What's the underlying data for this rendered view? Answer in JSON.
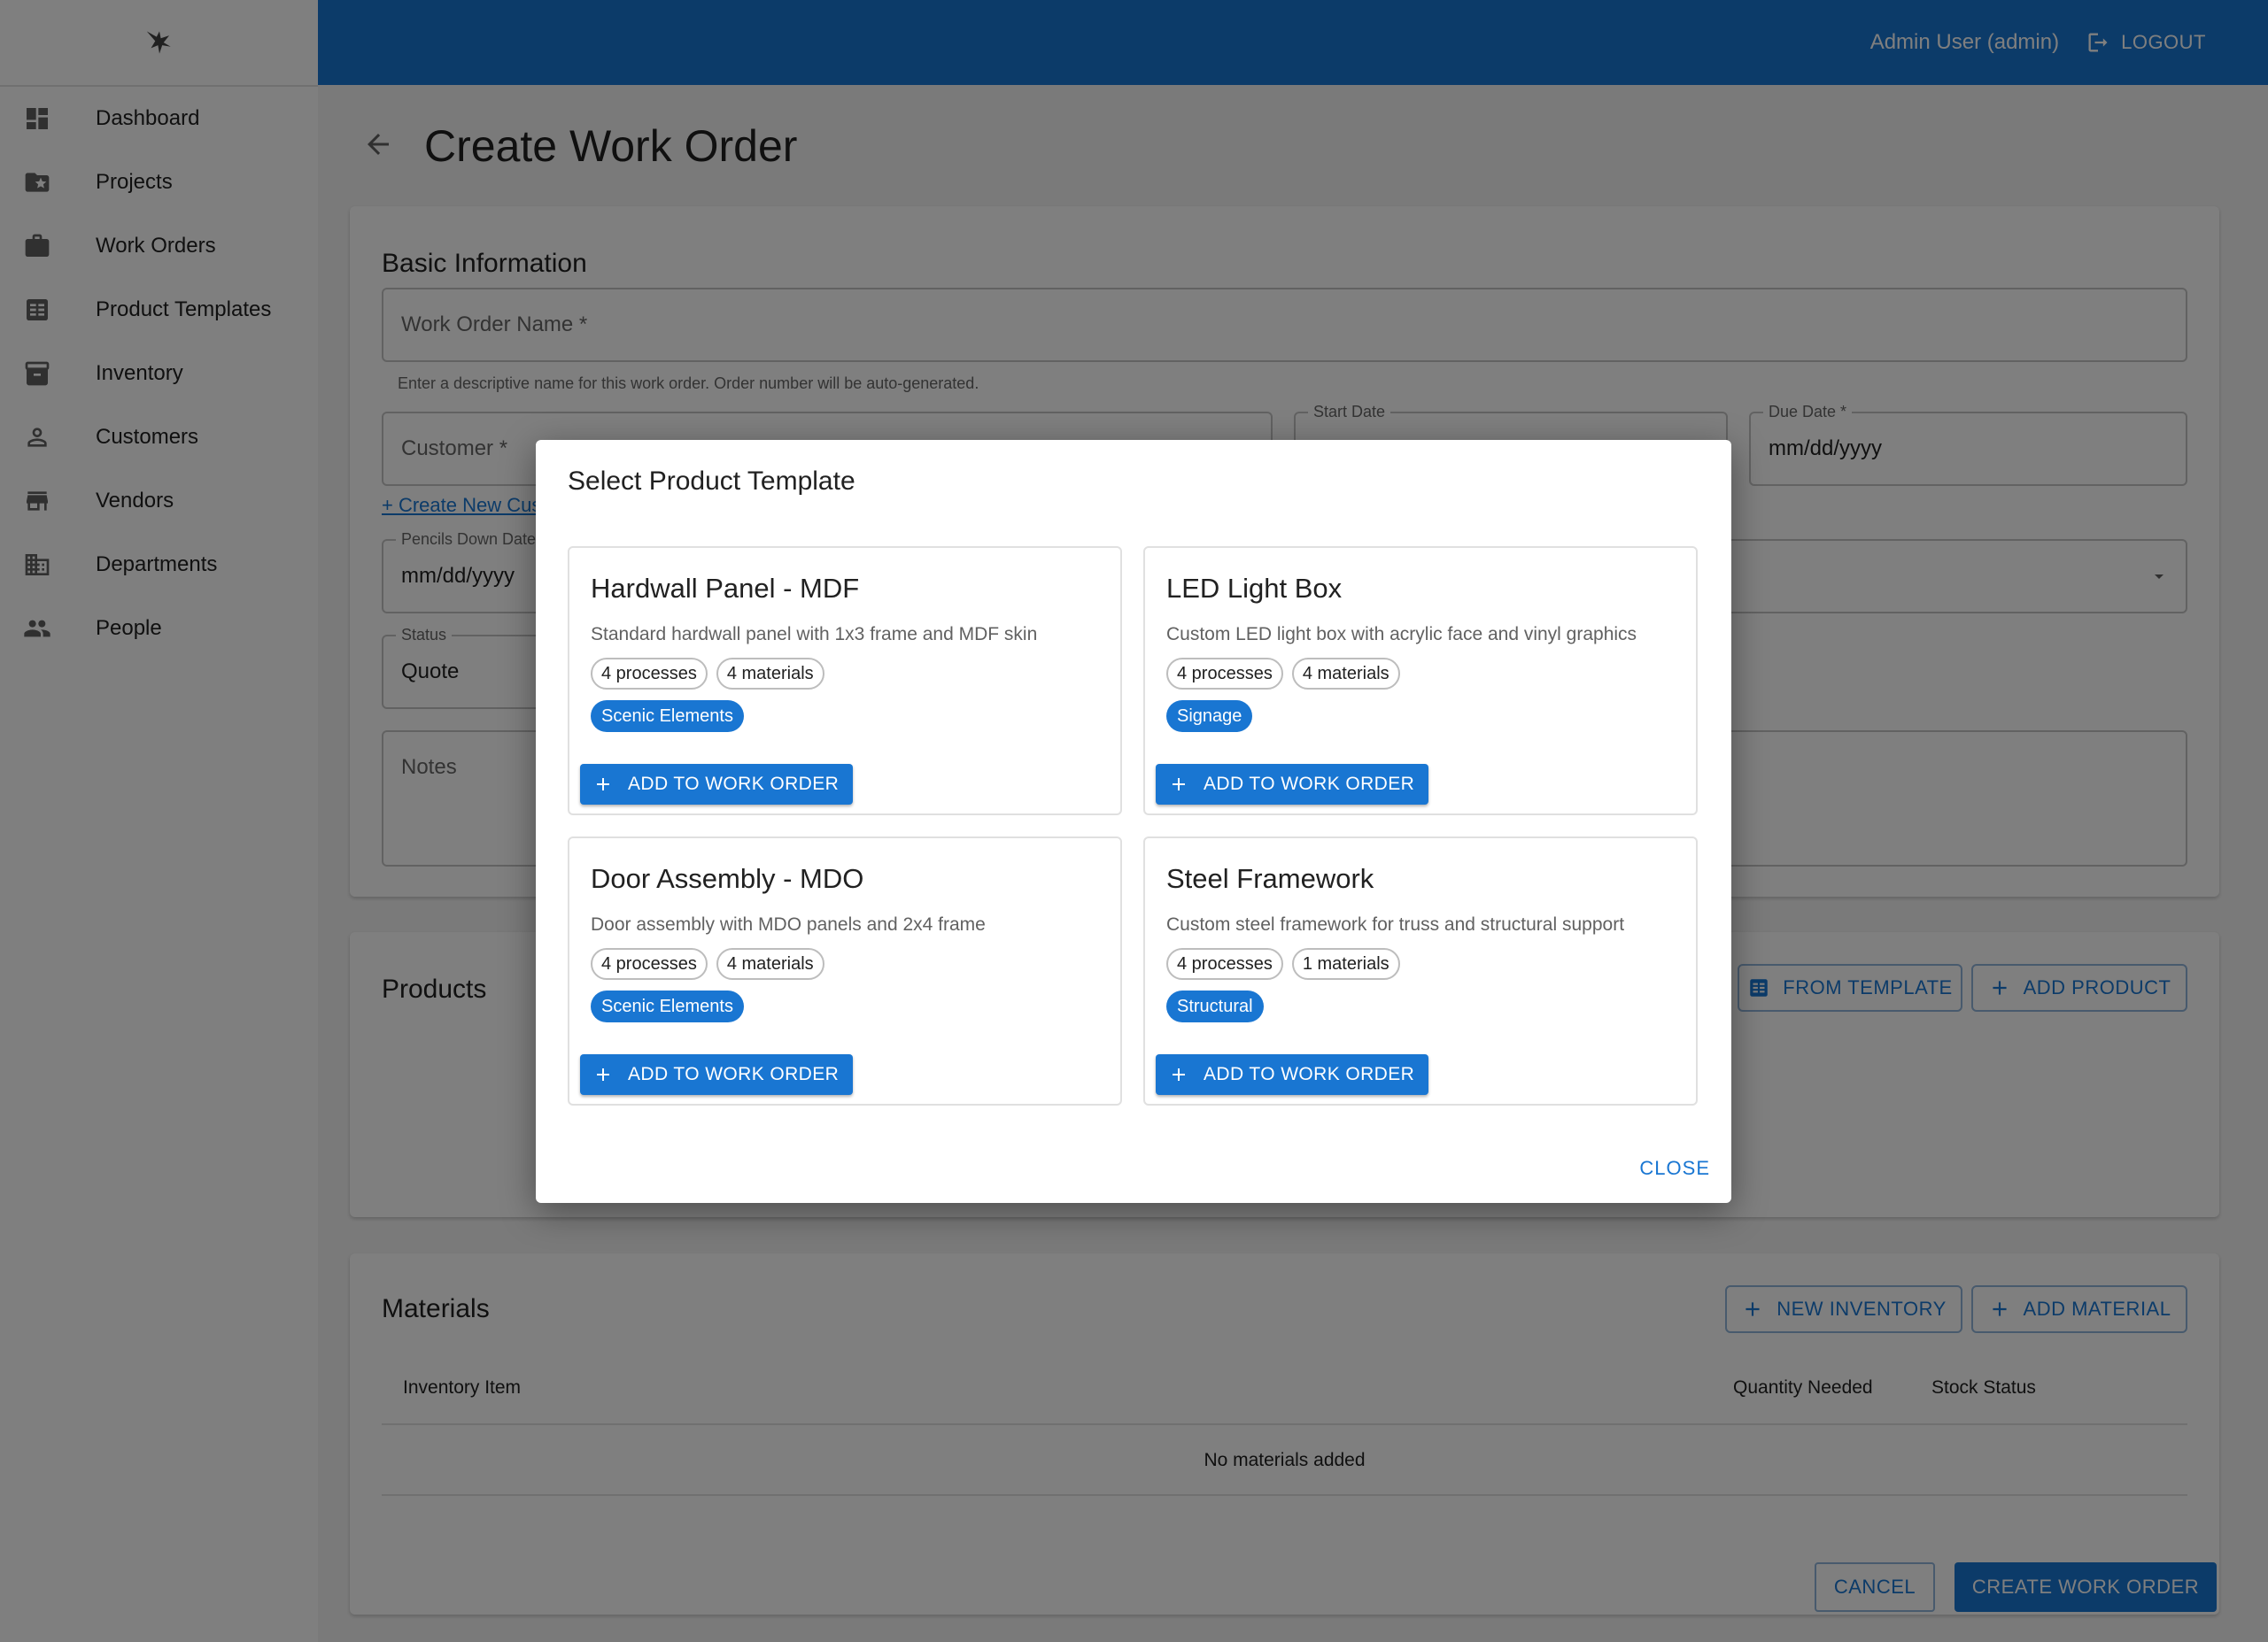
{
  "appbar": {
    "user": "Admin User (admin)",
    "logout": "LOGOUT"
  },
  "sidebar": {
    "items": [
      {
        "label": "Dashboard"
      },
      {
        "label": "Projects"
      },
      {
        "label": "Work Orders"
      },
      {
        "label": "Product Templates"
      },
      {
        "label": "Inventory"
      },
      {
        "label": "Customers"
      },
      {
        "label": "Vendors"
      },
      {
        "label": "Departments"
      },
      {
        "label": "People"
      }
    ]
  },
  "page": {
    "title": "Create Work Order"
  },
  "basic": {
    "title": "Basic Information",
    "name_label": "Work Order Name *",
    "name_helper": "Enter a descriptive name for this work order. Order number will be auto-generated.",
    "customer_label": "Customer *",
    "create_customer": "+ Create New Cus",
    "start_label": "Start Date",
    "due_label": "Due Date *",
    "due_value": "mm/dd/yyyy",
    "pencils_label": "Pencils Down Date",
    "pencils_value": "mm/dd/yyyy",
    "status_label": "Status",
    "status_value": "Quote",
    "notes_label": "Notes"
  },
  "products": {
    "title": "Products",
    "from_template": "FROM TEMPLATE",
    "add_product": "ADD PRODUCT"
  },
  "materials": {
    "title": "Materials",
    "new_inventory": "NEW INVENTORY",
    "add_material": "ADD MATERIAL",
    "columns": [
      "Inventory Item",
      "Quantity Needed",
      "Stock Status"
    ],
    "empty": "No materials added"
  },
  "footer": {
    "cancel": "CANCEL",
    "create": "CREATE WORK ORDER"
  },
  "dialog": {
    "title": "Select Product Template",
    "close": "CLOSE",
    "templates": [
      {
        "name": "Hardwall Panel - MDF",
        "desc": "Standard hardwall panel with 1x3 frame and MDF skin",
        "processes": "4 processes",
        "materials": "4 materials",
        "category": "Scenic Elements",
        "button": "ADD TO WORK ORDER"
      },
      {
        "name": "LED Light Box",
        "desc": "Custom LED light box with acrylic face and vinyl graphics",
        "processes": "4 processes",
        "materials": "4 materials",
        "category": "Signage",
        "button": "ADD TO WORK ORDER"
      },
      {
        "name": "Door Assembly - MDO",
        "desc": "Door assembly with MDO panels and 2x4 frame",
        "processes": "4 processes",
        "materials": "4 materials",
        "category": "Scenic Elements",
        "button": "ADD TO WORK ORDER"
      },
      {
        "name": "Steel Framework",
        "desc": "Custom steel framework for truss and structural support",
        "processes": "4 processes",
        "materials": "1 materials",
        "category": "Structural",
        "button": "ADD TO WORK ORDER"
      }
    ]
  }
}
